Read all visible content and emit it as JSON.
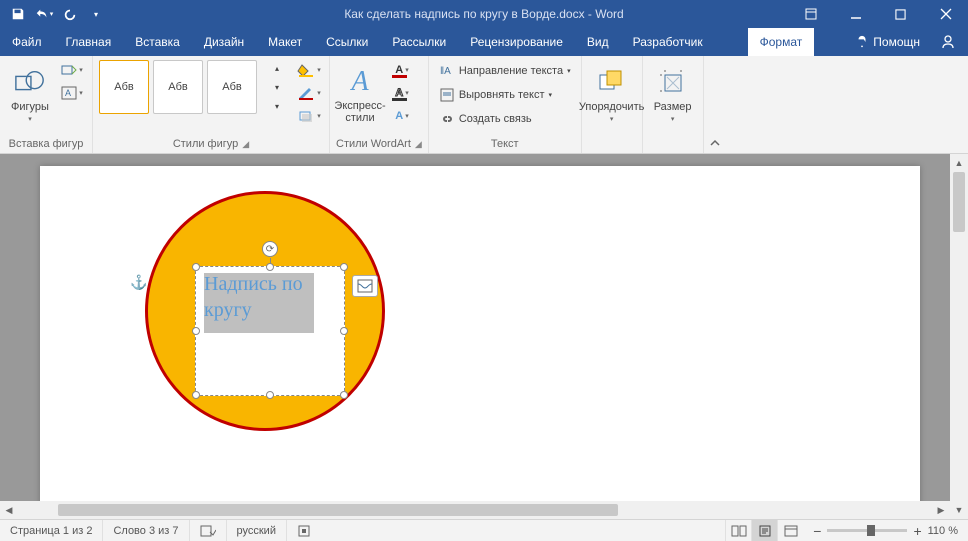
{
  "title": "Как сделать надпись по кругу в Ворде.docx - Word",
  "tabs": {
    "file": "Файл",
    "items": [
      "Главная",
      "Вставка",
      "Дизайн",
      "Макет",
      "Ссылки",
      "Рассылки",
      "Рецензирование",
      "Вид",
      "Разработчик"
    ],
    "format": "Формат",
    "help": "Помощн"
  },
  "ribbon": {
    "shapes": {
      "label": "Фигуры",
      "group": "Вставка фигур"
    },
    "styles": {
      "sample": "Абв",
      "group": "Стили фигур"
    },
    "wordart": {
      "label": "Экспресс-стили",
      "group": "Стили WordArt"
    },
    "text": {
      "direction": "Направление текста",
      "align": "Выровнять текст",
      "link": "Создать связь",
      "group": "Текст"
    },
    "arrange": {
      "label": "Упорядочить"
    },
    "size": {
      "label": "Размер"
    }
  },
  "document": {
    "textbox_text": "Надпись по кругу"
  },
  "statusbar": {
    "page": "Страница 1 из 2",
    "words": "Слово 3 из 7",
    "lang": "русский",
    "zoom": "110 %"
  }
}
